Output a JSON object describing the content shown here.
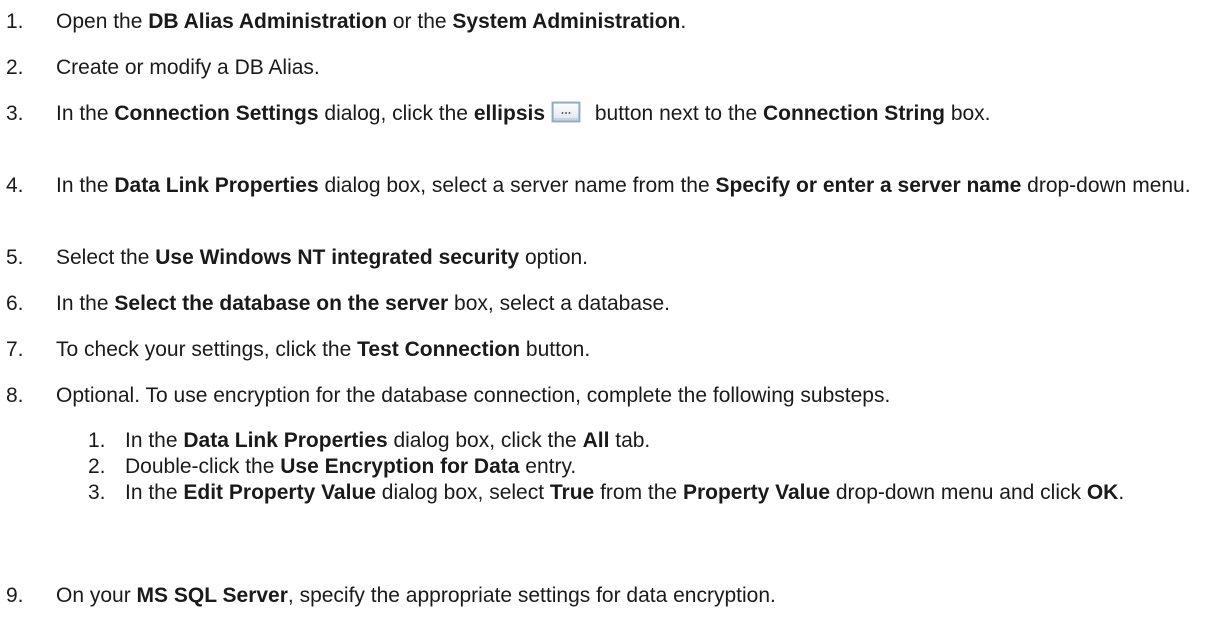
{
  "steps": [
    {
      "num": "1.",
      "p1": "Open the ",
      "b1": "DB Alias Administration",
      "p2": " or the ",
      "b2": "System Administration",
      "p3": "."
    },
    {
      "num": "2.",
      "text": "Create or modify a DB Alias."
    },
    {
      "num": "3.",
      "p1": "In the ",
      "b1": "Connection Settings",
      "p2": " dialog, click the ",
      "b2": "ellipsis",
      "icon": "ellipsis-button-icon",
      "p3": " button next to the ",
      "b3": "Connection String",
      "p4": " box."
    },
    {
      "num": "4.",
      "p1": "In the ",
      "b1": "Data Link Properties",
      "p2": " dialog box, select a server name from the ",
      "b2": "Specify or enter a server name",
      "p3": " drop-down menu."
    },
    {
      "num": "5.",
      "p1": "Select the ",
      "b1": "Use Windows NT integrated security",
      "p2": " option."
    },
    {
      "num": "6.",
      "p1": "In the ",
      "b1": "Select the database on the server",
      "p2": " box, select a database."
    },
    {
      "num": "7.",
      "p1": "To check your settings, click the ",
      "b1": "Test Connection",
      "p2": " button."
    },
    {
      "num": "8.",
      "text": "Optional. To use encryption for the database connection, complete the following substeps."
    },
    {
      "num": "9.",
      "p1": "On your ",
      "b1": "MS SQL Server",
      "p2": ", specify the appropriate settings for data encryption."
    }
  ],
  "substeps": [
    {
      "num": "1.",
      "p1": "In the ",
      "b1": "Data Link Properties",
      "p2": " dialog box, click the ",
      "b2": "All",
      "p3": " tab."
    },
    {
      "num": "2.",
      "p1": "Double-click the ",
      "b1": "Use Encryption for Data",
      "p2": " entry."
    },
    {
      "num": "3.",
      "p1": "In the ",
      "b1": "Edit Property Value",
      "p2": " dialog box, select ",
      "b2": "True",
      "p3": " from the ",
      "b3": "Property Value",
      "p4": " drop-down menu and click ",
      "b4": "OK",
      "p5": "."
    }
  ]
}
